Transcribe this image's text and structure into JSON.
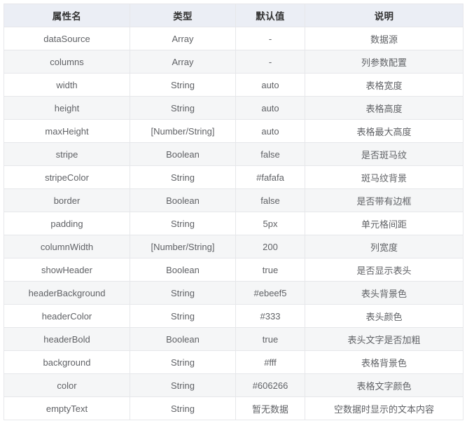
{
  "table": {
    "columns": [
      {
        "key": "attr",
        "label": "属性名"
      },
      {
        "key": "type",
        "label": "类型"
      },
      {
        "key": "default",
        "label": "默认值"
      },
      {
        "key": "desc",
        "label": "说明"
      }
    ],
    "rows": [
      {
        "attr": "dataSource",
        "type": "Array",
        "default": "-",
        "desc": "数据源"
      },
      {
        "attr": "columns",
        "type": "Array",
        "default": "-",
        "desc": "列参数配置"
      },
      {
        "attr": "width",
        "type": "String",
        "default": "auto",
        "desc": "表格宽度"
      },
      {
        "attr": "height",
        "type": "String",
        "default": "auto",
        "desc": "表格高度"
      },
      {
        "attr": "maxHeight",
        "type": "[Number/String]",
        "default": "auto",
        "desc": "表格最大高度"
      },
      {
        "attr": "stripe",
        "type": "Boolean",
        "default": "false",
        "desc": "是否斑马纹"
      },
      {
        "attr": "stripeColor",
        "type": "String",
        "default": "#fafafa",
        "desc": "斑马纹背景"
      },
      {
        "attr": "border",
        "type": "Boolean",
        "default": "false",
        "desc": "是否带有边框"
      },
      {
        "attr": "padding",
        "type": "String",
        "default": "5px",
        "desc": "单元格间距"
      },
      {
        "attr": "columnWidth",
        "type": "[Number/String]",
        "default": "200",
        "desc": "列宽度"
      },
      {
        "attr": "showHeader",
        "type": "Boolean",
        "default": "true",
        "desc": "是否显示表头"
      },
      {
        "attr": "headerBackground",
        "type": "String",
        "default": "#ebeef5",
        "desc": "表头背景色"
      },
      {
        "attr": "headerColor",
        "type": "String",
        "default": "#333",
        "desc": "表头颜色"
      },
      {
        "attr": "headerBold",
        "type": "Boolean",
        "default": "true",
        "desc": "表头文字是否加粗"
      },
      {
        "attr": "background",
        "type": "String",
        "default": "#fff",
        "desc": "表格背景色"
      },
      {
        "attr": "color",
        "type": "String",
        "default": "#606266",
        "desc": "表格文字颜色"
      },
      {
        "attr": "emptyText",
        "type": "String",
        "default": "暂无数据",
        "desc": "空数据时显示的文本内容"
      }
    ]
  },
  "colors": {
    "header_background": "#ebeef5",
    "header_color": "#333333",
    "body_color": "#606266",
    "stripe_background": "#f5f6f7",
    "row_background": "#ffffff",
    "border": "#e6e7ea"
  }
}
